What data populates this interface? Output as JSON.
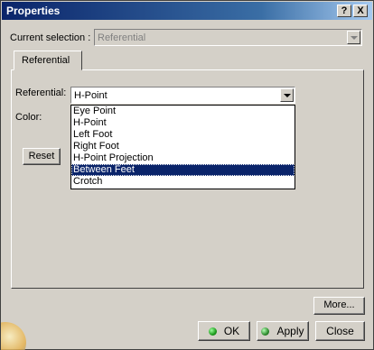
{
  "window": {
    "title": "Properties",
    "help_glyph": "?",
    "close_glyph": "X"
  },
  "current_selection": {
    "label": "Current selection :",
    "value": "Referential"
  },
  "tabs": [
    {
      "label": "Referential",
      "active": true
    }
  ],
  "referential": {
    "label": "Referential:",
    "selected": "H-Point",
    "options": [
      "Eye Point",
      "H-Point",
      "Left Foot",
      "Right Foot",
      "H-Point Projection",
      "Between Feet",
      "Crotch"
    ],
    "highlighted": "Between Feet"
  },
  "color": {
    "label": "Color:"
  },
  "buttons": {
    "reset": "Reset",
    "more": "More...",
    "ok": "OK",
    "apply": "Apply",
    "close": "Close"
  },
  "colors": {
    "titlebar": "#0a246a",
    "ok_led": "#1c9a1c",
    "apply_led": "#2e8b2e",
    "selection": "#0a246a"
  },
  "icons": [
    "help-icon",
    "close-icon",
    "chevron-down-icon",
    "ok-status-icon",
    "apply-status-icon",
    "globe-logo-icon"
  ]
}
